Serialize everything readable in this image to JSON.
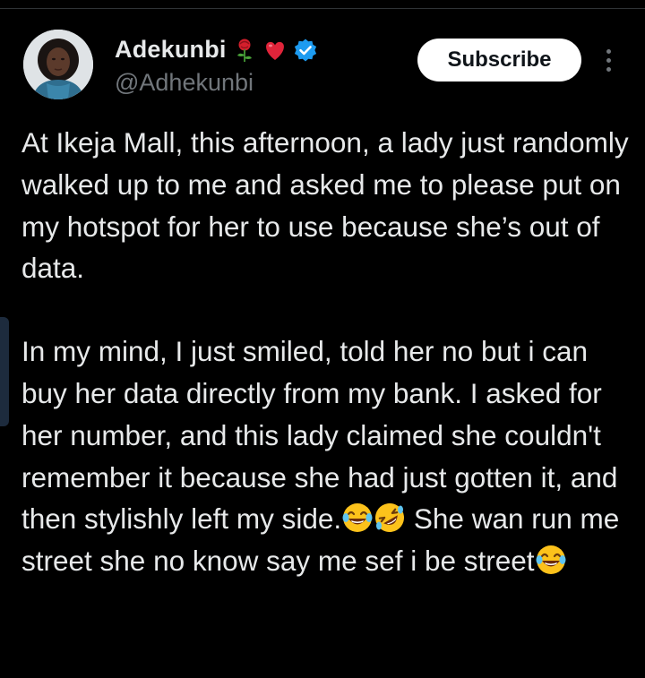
{
  "author": {
    "display_name": "Adekunbi",
    "name_emojis": [
      "rose-icon",
      "red-heart-icon"
    ],
    "verified": true,
    "handle": "@Adhekunbi"
  },
  "actions": {
    "subscribe_label": "Subscribe"
  },
  "tweet": {
    "paragraph_1": "At Ikeja Mall, this afternoon, a lady just randomly walked up to me and asked me to please put on my hotspot for her to use because she’s out of data.",
    "paragraph_2_a": "In my mind, I just smiled, told her no but i can buy her data directly from my bank. I asked for her number, and this lady claimed she couldn't remember it because she had just gotten it, and then stylishly left my side.",
    "paragraph_2_b": " She wan run me street she no know say me sef i be street",
    "emojis": [
      "laughing-tears-icon",
      "rolling-laughing-icon"
    ]
  },
  "colors": {
    "background": "#000000",
    "text": "#e7e9ea",
    "secondary": "#71767b",
    "verified": "#1d9bf0",
    "button_bg": "#ffffff",
    "button_text": "#0f1419"
  }
}
